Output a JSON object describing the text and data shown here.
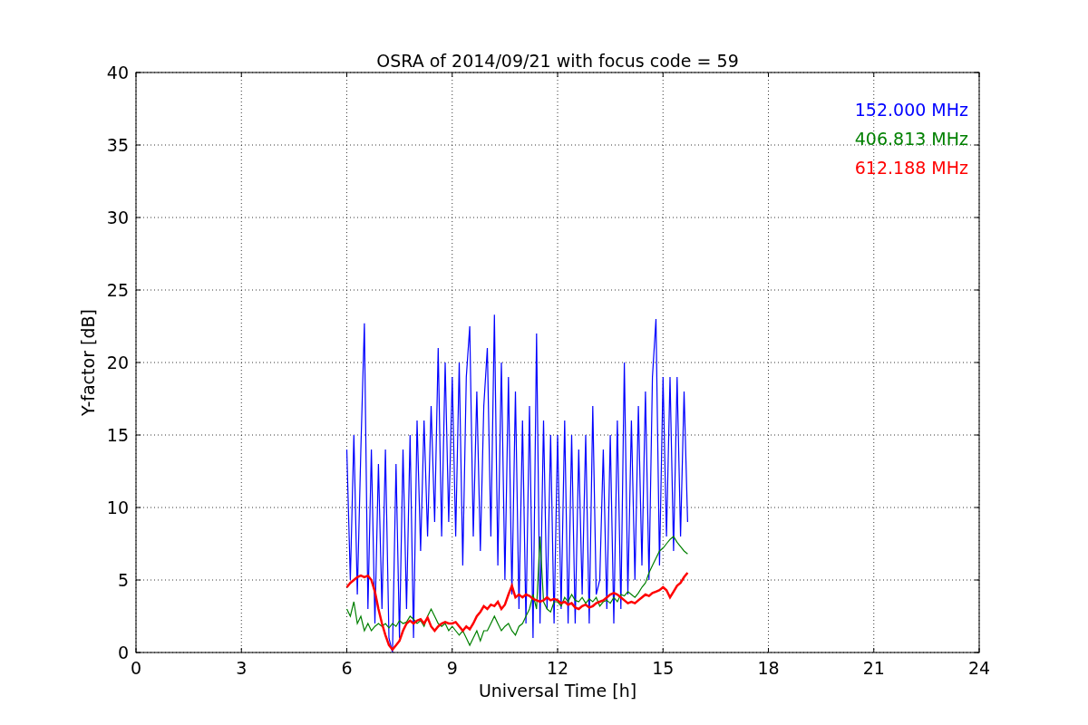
{
  "chart_data": {
    "type": "line",
    "title": "OSRA of 2014/09/21 with focus code = 59",
    "xlabel": "Universal Time [h]",
    "ylabel": "Y-factor [dB]",
    "grid": true,
    "xlim": [
      0,
      24
    ],
    "ylim": [
      0,
      40
    ],
    "xticks": [
      0,
      3,
      6,
      9,
      12,
      15,
      18,
      21,
      24
    ],
    "yticks": [
      0,
      5,
      10,
      15,
      20,
      25,
      30,
      35,
      40
    ],
    "x": [
      6,
      6.1,
      6.2,
      6.3,
      6.4,
      6.5,
      6.6,
      6.7,
      6.8,
      6.9,
      7,
      7.1,
      7.2,
      7.3,
      7.4,
      7.5,
      7.6,
      7.7,
      7.8,
      7.9,
      8,
      8.1,
      8.2,
      8.3,
      8.4,
      8.5,
      8.6,
      8.7,
      8.8,
      8.9,
      9,
      9.1,
      9.2,
      9.3,
      9.4,
      9.5,
      9.6,
      9.7,
      9.8,
      9.9,
      10,
      10.1,
      10.2,
      10.3,
      10.4,
      10.5,
      10.6,
      10.7,
      10.8,
      10.9,
      11,
      11.1,
      11.2,
      11.3,
      11.4,
      11.5,
      11.6,
      11.7,
      11.8,
      11.9,
      12,
      12.1,
      12.2,
      12.3,
      12.4,
      12.5,
      12.6,
      12.7,
      12.8,
      12.9,
      13,
      13.1,
      13.2,
      13.3,
      13.4,
      13.5,
      13.6,
      13.7,
      13.8,
      13.9,
      14,
      14.1,
      14.2,
      14.3,
      14.4,
      14.5,
      14.6,
      14.7,
      14.8,
      14.9,
      15,
      15.1,
      15.2,
      15.3,
      15.4,
      15.5,
      15.6,
      15.7
    ],
    "series": [
      {
        "name": "152.000 MHz",
        "color": "#0000ff",
        "values": [
          14,
          5,
          15,
          4,
          14,
          22.7,
          3,
          14,
          2,
          13,
          3,
          14,
          1,
          0,
          13,
          1,
          14,
          3,
          15,
          1,
          16,
          7,
          16,
          8,
          17,
          9,
          21,
          8,
          20,
          9,
          19,
          8,
          20,
          6,
          19,
          22.5,
          8,
          18,
          7,
          17,
          21,
          8,
          23.3,
          6,
          20,
          5,
          19,
          4,
          18,
          3,
          16,
          2,
          17,
          1,
          22,
          2,
          16,
          3,
          15,
          2,
          15,
          3,
          16,
          2,
          15,
          2,
          14,
          4,
          15,
          2,
          17,
          4,
          5,
          14,
          3,
          15,
          2,
          16,
          3,
          20,
          4,
          16,
          5,
          17,
          6,
          18,
          5,
          19,
          23,
          6,
          19,
          8,
          19,
          7,
          19,
          8,
          18,
          9
        ]
      },
      {
        "name": "406.813 MHz",
        "color": "#008000",
        "values": [
          3,
          2.5,
          3.5,
          2,
          2.5,
          1.5,
          2,
          1.5,
          1.8,
          2,
          1.8,
          2,
          1.7,
          2,
          1.8,
          2.2,
          2,
          2.1,
          2.5,
          2.3,
          2,
          2.2,
          1.8,
          2.5,
          3,
          2.5,
          2,
          1.8,
          2,
          1.5,
          1.8,
          1.5,
          1.2,
          1.5,
          1,
          0.5,
          1,
          1.5,
          0.8,
          1.5,
          1.5,
          2,
          2.5,
          2,
          1.5,
          1.8,
          2,
          1.5,
          1.2,
          1.8,
          2,
          2.5,
          3,
          4,
          3,
          8,
          3.5,
          3,
          2.8,
          3.5,
          3.5,
          3.2,
          3.8,
          3.5,
          4,
          3.6,
          3.5,
          3.8,
          3.4,
          3.7,
          3.5,
          3.8,
          3.2,
          3.5,
          3.6,
          3.4,
          3.8,
          3.5,
          4,
          3.9,
          4.2,
          4,
          3.8,
          4.1,
          4.5,
          4.8,
          5.5,
          6,
          6.5,
          7,
          7.2,
          7.5,
          7.8,
          8,
          7.6,
          7.3,
          7,
          6.8
        ]
      },
      {
        "name": "612.188 MHz",
        "color": "#ff0000",
        "values": [
          4.5,
          4.8,
          5,
          5.2,
          5.3,
          5.2,
          5.3,
          5,
          4.2,
          3,
          2,
          1.2,
          0.5,
          0.2,
          0.5,
          0.8,
          1.5,
          2,
          2.2,
          2,
          2.2,
          2.3,
          2,
          2.4,
          1.8,
          1.5,
          1.8,
          2,
          2.1,
          2,
          2,
          2.1,
          1.8,
          1.5,
          1.8,
          1.6,
          2,
          2.5,
          2.8,
          3.2,
          3,
          3.3,
          3.2,
          3.5,
          3,
          3.3,
          4,
          4.6,
          3.8,
          4,
          3.8,
          4,
          3.9,
          3.7,
          3.6,
          3.5,
          3.6,
          3.8,
          3.6,
          3.7,
          3.6,
          3.4,
          3.5,
          3.3,
          3.4,
          3.1,
          3,
          3.2,
          3.3,
          3.1,
          3.2,
          3.4,
          3.5,
          3.6,
          3.8,
          4,
          4.1,
          4,
          3.8,
          3.6,
          3.4,
          3.5,
          3.4,
          3.6,
          3.8,
          4,
          3.9,
          4.1,
          4.2,
          4.3,
          4.5,
          4.3,
          3.8,
          4.2,
          4.6,
          4.8,
          5.2,
          5.5
        ]
      }
    ]
  }
}
